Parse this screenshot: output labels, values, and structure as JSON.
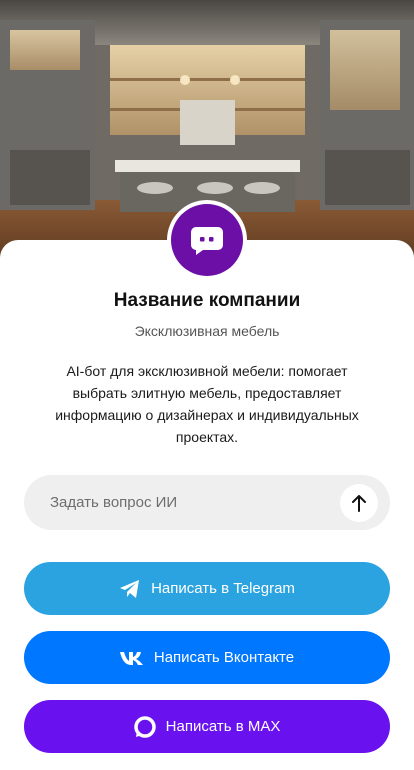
{
  "company": {
    "name": "Название компании",
    "tagline": "Эксклюзивная мебель",
    "description": "AI-бот для эксклюзивной мебели: помогает выбрать элитную мебель, предоставляет информацию о дизайнерах и индивидуальных проектах."
  },
  "ask": {
    "placeholder": "Задать вопрос ИИ",
    "send_icon": "arrow-up-icon"
  },
  "buttons": [
    {
      "label": "Написать в Telegram",
      "icon": "telegram-icon",
      "color": "#2aa3e0"
    },
    {
      "label": "Написать Вконтакте",
      "icon": "vk-icon",
      "color": "#0077ff"
    },
    {
      "label": "Написать в MAX",
      "icon": "max-icon",
      "color": "#6a11f0"
    }
  ],
  "colors": {
    "avatar": "#6b0fa6"
  }
}
